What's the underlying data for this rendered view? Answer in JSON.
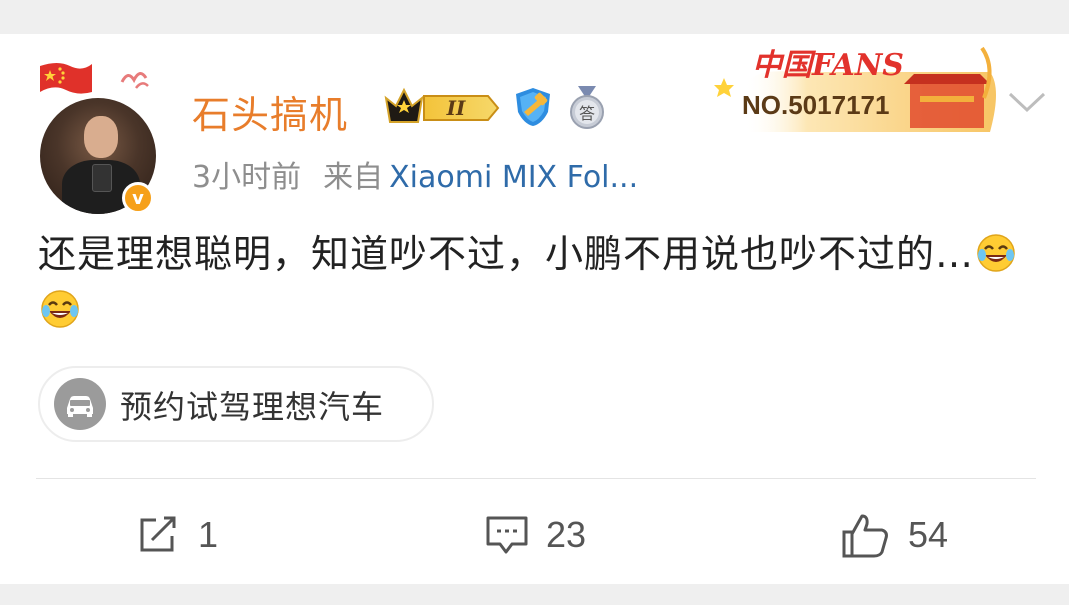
{
  "post": {
    "username": "石头搞机",
    "time": "3小时前",
    "source_prefix": "来自",
    "device": "Xiaomi MIX Fol...",
    "content": "还是理想聪明，知道吵不过，小鹏不用说也吵不过的…",
    "emojis": [
      "laugh-cry-emoji",
      "laugh-cry-emoji"
    ]
  },
  "badges": {
    "crown_level": "II",
    "fans_title": "中国FANS",
    "fans_no": "NO.5017171",
    "medal_char": "答"
  },
  "topic_pill": {
    "label": "预约试驾理想汽车",
    "icon": "car-icon"
  },
  "actions": {
    "repost_count": "1",
    "comment_count": "23",
    "like_count": "54"
  },
  "colors": {
    "username": "#e87d2b",
    "device_link": "#2f6ba9",
    "meta": "#8e8e8e",
    "vip_badge": "#f6a01a"
  }
}
